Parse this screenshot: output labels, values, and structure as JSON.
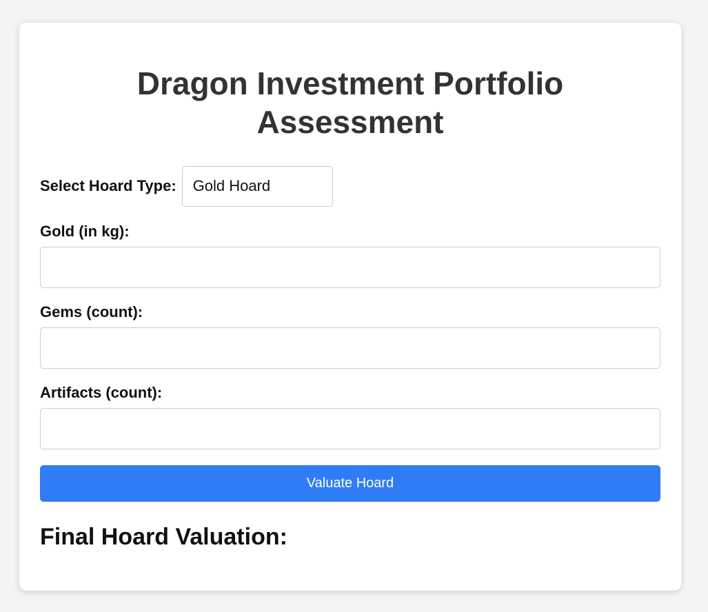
{
  "page": {
    "title_line1": "Dragon Investment Portfolio",
    "title_line2": "Assessment"
  },
  "form": {
    "hoard_type_label": "Select Hoard Type:",
    "hoard_type_selected": "Gold Hoard",
    "gold_label": "Gold (in kg):",
    "gold_value": "",
    "gems_label": "Gems (count):",
    "gems_value": "",
    "artifacts_label": "Artifacts (count):",
    "artifacts_value": "",
    "submit_label": "Valuate Hoard"
  },
  "result": {
    "heading": "Final Hoard Valuation:",
    "value": ""
  },
  "colors": {
    "page_background": "#f4f4f4",
    "card_background": "#ffffff",
    "title_text": "#333333",
    "button_background": "#2f7cf6",
    "button_text": "#ffffff",
    "input_border": "#cccccc"
  }
}
